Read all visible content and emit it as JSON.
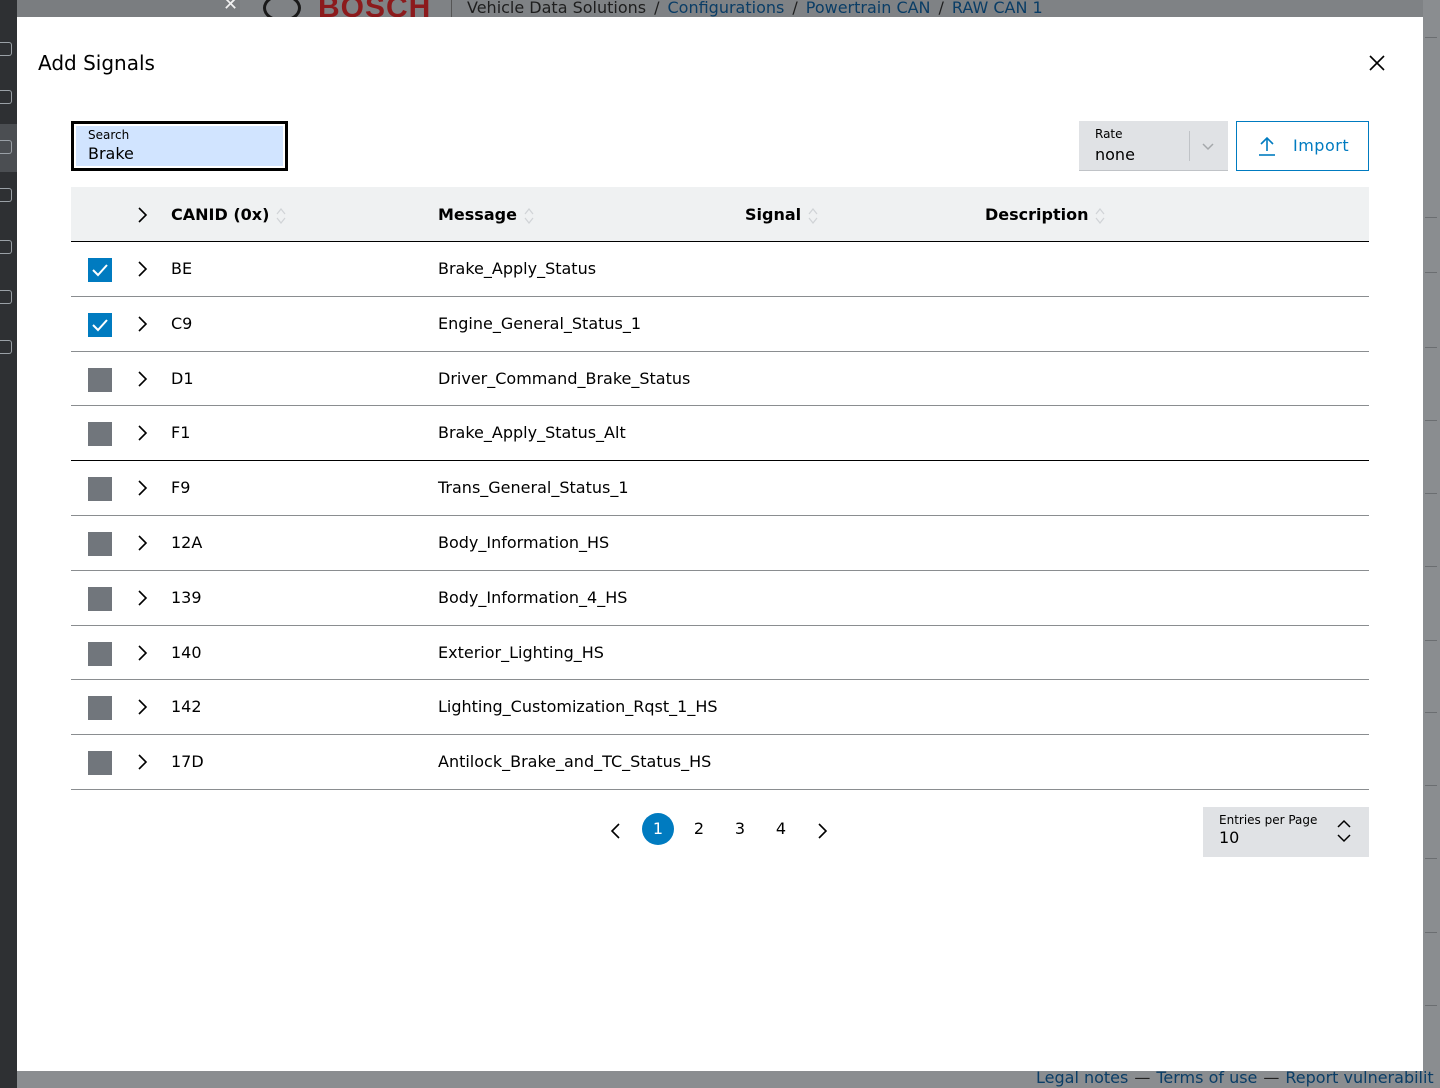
{
  "background": {
    "brand": "BOSCH",
    "breadcrumb": {
      "root": "Vehicle Data Solutions",
      "links": [
        "Configurations",
        "Powertrain CAN",
        "RAW CAN 1"
      ]
    },
    "footer": {
      "links": [
        "Legal notes",
        "Terms of use",
        "Report vulnerabilit"
      ]
    }
  },
  "modal": {
    "title": "Add Signals",
    "search": {
      "label": "Search",
      "value": "Brake"
    },
    "rate": {
      "label": "Rate",
      "value": "none"
    },
    "import_label": "Import",
    "table": {
      "columns": [
        "CANID (0x)",
        "Message",
        "Signal",
        "Description"
      ],
      "rows": [
        {
          "canid": "BE",
          "message": "Brake_Apply_Status",
          "signal": "",
          "description": "",
          "checked": true
        },
        {
          "canid": "C9",
          "message": "Engine_General_Status_1",
          "signal": "",
          "description": "",
          "checked": true
        },
        {
          "canid": "D1",
          "message": "Driver_Command_Brake_Status",
          "signal": "",
          "description": "",
          "checked": false
        },
        {
          "canid": "F1",
          "message": "Brake_Apply_Status_Alt",
          "signal": "",
          "description": "",
          "checked": false
        },
        {
          "canid": "F9",
          "message": "Trans_General_Status_1",
          "signal": "",
          "description": "",
          "checked": false
        },
        {
          "canid": "12A",
          "message": "Body_Information_HS",
          "signal": "",
          "description": "",
          "checked": false
        },
        {
          "canid": "139",
          "message": "Body_Information_4_HS",
          "signal": "",
          "description": "",
          "checked": false
        },
        {
          "canid": "140",
          "message": "Exterior_Lighting_HS",
          "signal": "",
          "description": "",
          "checked": false
        },
        {
          "canid": "142",
          "message": "Lighting_Customization_Rqst_1_HS",
          "signal": "",
          "description": "",
          "checked": false
        },
        {
          "canid": "17D",
          "message": "Antilock_Brake_and_TC_Status_HS",
          "signal": "",
          "description": "",
          "checked": false
        }
      ]
    },
    "pagination": {
      "pages": [
        "1",
        "2",
        "3",
        "4"
      ],
      "current": "1"
    },
    "entries_per_page": {
      "label": "Entries per Page",
      "value": "10"
    }
  },
  "colors": {
    "accent": "#007bc0",
    "search_bg": "#d1e4ff",
    "checkbox_off": "#71767c",
    "header_bg": "#eff1f2",
    "brand_red": "#8c1a1c"
  },
  "icons": [
    "close-icon",
    "chevron-right-icon",
    "chevron-left-icon",
    "chevron-down-icon",
    "upload-icon",
    "sort-icon",
    "checkmark-icon",
    "chevron-up-down-icon"
  ]
}
